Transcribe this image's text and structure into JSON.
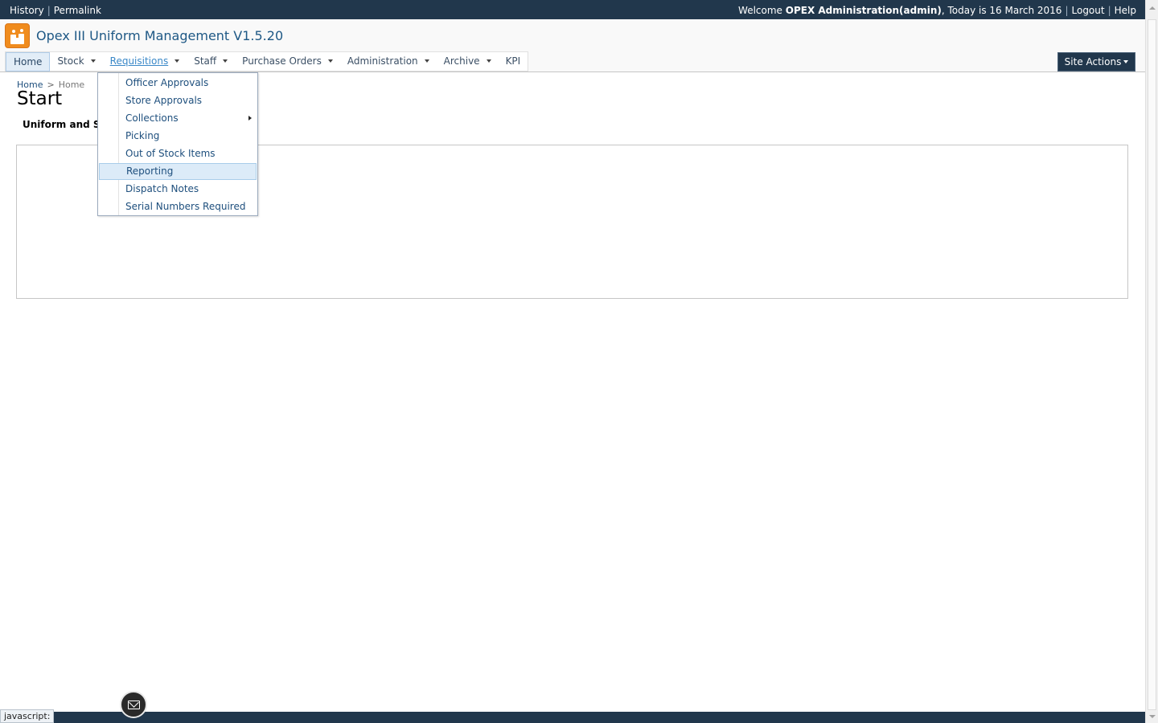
{
  "topbar": {
    "links": [
      "History",
      "Permalink"
    ],
    "welcome_prefix": "Welcome",
    "user": "OPEX Administration(admin)",
    "date_text": ", Today is 16 March 2016",
    "logout": "Logout",
    "help": "Help"
  },
  "site": {
    "title": "Opex III Uniform Management V1.5.20",
    "logo_color": "#f08c1e"
  },
  "nav": {
    "items": [
      {
        "label": "Home"
      },
      {
        "label": "Stock"
      },
      {
        "label": "Requisitions"
      },
      {
        "label": "Staff"
      },
      {
        "label": "Purchase Orders"
      },
      {
        "label": "Administration"
      },
      {
        "label": "Archive"
      },
      {
        "label": "KPI"
      }
    ],
    "site_actions": "Site Actions"
  },
  "dropdown": {
    "items": [
      {
        "label": "Officer Approvals"
      },
      {
        "label": "Store Approvals"
      },
      {
        "label": "Collections"
      },
      {
        "label": "Picking"
      },
      {
        "label": "Out of Stock Items"
      },
      {
        "label": "Reporting"
      },
      {
        "label": "Dispatch Notes"
      },
      {
        "label": "Serial Numbers Required"
      }
    ]
  },
  "breadcrumb": {
    "root": "Home",
    "separator": ">",
    "current": "Home"
  },
  "page": {
    "title": "Start",
    "subheading": "Uniform and S"
  },
  "status": {
    "text": "javascript:"
  },
  "theme": {
    "header_bg": "#21374c",
    "link_color": "#1e4f7d",
    "hover_color": "#3a88c8"
  }
}
